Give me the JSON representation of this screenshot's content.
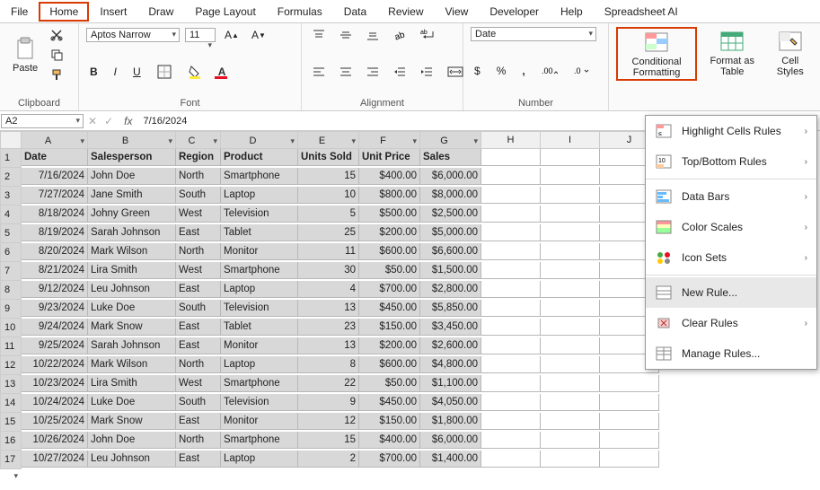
{
  "menu": {
    "file": "File",
    "home": "Home",
    "insert": "Insert",
    "draw": "Draw",
    "page": "Page Layout",
    "formulas": "Formulas",
    "data": "Data",
    "review": "Review",
    "view": "View",
    "developer": "Developer",
    "help": "Help",
    "ai": "Spreadsheet AI"
  },
  "ribbon": {
    "clipboard": {
      "label": "Clipboard",
      "paste": "Paste"
    },
    "font": {
      "label": "Font",
      "name": "Aptos Narrow",
      "size": "11",
      "bold": "B",
      "italic": "I",
      "underline": "U"
    },
    "alignment": {
      "label": "Alignment"
    },
    "number": {
      "label": "Number",
      "format": "Date",
      "currency": "$",
      "percent": "%",
      "comma": ","
    },
    "styles": {
      "cf": "Conditional Formatting",
      "fat": "Format as Table",
      "cs": "Cell Styles"
    }
  },
  "fbar": {
    "name": "A2",
    "value": "7/16/2024"
  },
  "cols": [
    "A",
    "B",
    "C",
    "D",
    "E",
    "F",
    "G",
    "H",
    "I",
    "J"
  ],
  "headers": [
    "Date",
    "Salesperson",
    "Region",
    "Product",
    "Units Sold",
    "Unit Price",
    "Sales"
  ],
  "rows": [
    [
      "7/16/2024",
      "John Doe",
      "North",
      "Smartphone",
      "15",
      "$400.00",
      "$6,000.00"
    ],
    [
      "7/27/2024",
      "Jane Smith",
      "South",
      "Laptop",
      "10",
      "$800.00",
      "$8,000.00"
    ],
    [
      "8/18/2024",
      "Johny Green",
      "West",
      "Television",
      "5",
      "$500.00",
      "$2,500.00"
    ],
    [
      "8/19/2024",
      "Sarah Johnson",
      "East",
      "Tablet",
      "25",
      "$200.00",
      "$5,000.00"
    ],
    [
      "8/20/2024",
      "Mark Wilson",
      "North",
      "Monitor",
      "11",
      "$600.00",
      "$6,600.00"
    ],
    [
      "8/21/2024",
      "Lira Smith",
      "West",
      "Smartphone",
      "30",
      "$50.00",
      "$1,500.00"
    ],
    [
      "9/12/2024",
      "Leu Johnson",
      "East",
      "Laptop",
      "4",
      "$700.00",
      "$2,800.00"
    ],
    [
      "9/23/2024",
      "Luke Doe",
      "South",
      "Television",
      "13",
      "$450.00",
      "$5,850.00"
    ],
    [
      "9/24/2024",
      "Mark Snow",
      "East",
      "Tablet",
      "23",
      "$150.00",
      "$3,450.00"
    ],
    [
      "9/25/2024",
      "Sarah Johnson",
      "East",
      "Monitor",
      "13",
      "$200.00",
      "$2,600.00"
    ],
    [
      "10/22/2024",
      "Mark Wilson",
      "North",
      "Laptop",
      "8",
      "$600.00",
      "$4,800.00"
    ],
    [
      "10/23/2024",
      "Lira Smith",
      "West",
      "Smartphone",
      "22",
      "$50.00",
      "$1,100.00"
    ],
    [
      "10/24/2024",
      "Luke Doe",
      "South",
      "Television",
      "9",
      "$450.00",
      "$4,050.00"
    ],
    [
      "10/25/2024",
      "Mark Snow",
      "East",
      "Monitor",
      "12",
      "$150.00",
      "$1,800.00"
    ],
    [
      "10/26/2024",
      "John Doe",
      "North",
      "Smartphone",
      "15",
      "$400.00",
      "$6,000.00"
    ],
    [
      "10/27/2024",
      "Leu Johnson",
      "East",
      "Laptop",
      "2",
      "$700.00",
      "$1,400.00"
    ]
  ],
  "dd": {
    "hcr": "Highlight Cells Rules",
    "tbr": "Top/Bottom Rules",
    "db": "Data Bars",
    "cs": "Color Scales",
    "is": "Icon Sets",
    "nr": "New Rule...",
    "cr": "Clear Rules",
    "mr": "Manage Rules..."
  }
}
